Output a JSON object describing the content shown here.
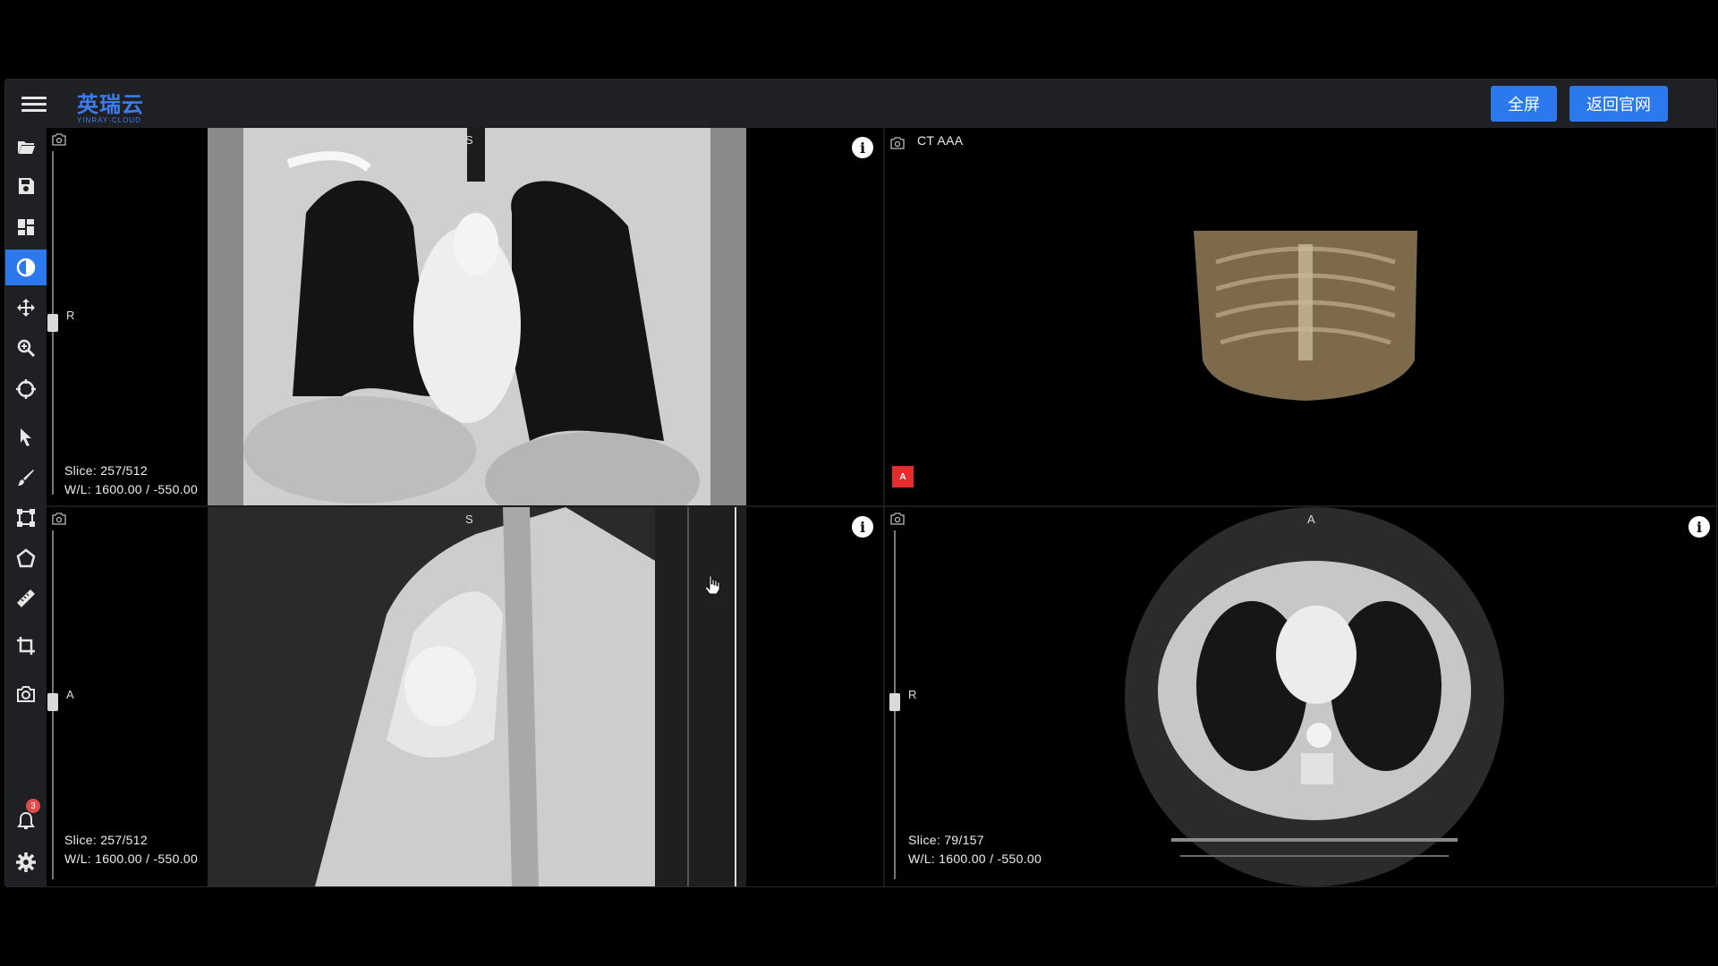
{
  "header": {
    "logo_cn": "英瑞云",
    "logo_en": "YINRAY·CLOUD",
    "fullscreen_label": "全屏",
    "back_label": "返回官网"
  },
  "sidebar": {
    "tools": [
      "folder-open-icon",
      "save-icon",
      "layout-icon",
      "window-level-icon",
      "pan-icon",
      "zoom-icon",
      "crosshair-icon",
      "pointer-icon",
      "brush-icon",
      "bounding-box-icon",
      "polygon-icon",
      "ruler-icon",
      "crop-icon",
      "snapshot-icon",
      "bell-icon",
      "settings-icon"
    ],
    "active_tool": "window-level-icon",
    "notification_count": "3"
  },
  "viewports": {
    "coronal": {
      "orientation_top": "S",
      "orientation_left": "R",
      "slice": "Slice: 257/512",
      "wl": "W/L: 1600.00 / -550.00"
    },
    "volume": {
      "series": "CT AAA",
      "marker": "A"
    },
    "sagittal": {
      "orientation_top": "S",
      "orientation_left": "A",
      "slice": "Slice: 257/512",
      "wl": "W/L: 1600.00 / -550.00"
    },
    "axial": {
      "orientation_top": "A",
      "orientation_left": "R",
      "slice": "Slice: 79/157",
      "wl": "W/L: 1600.00 / -550.00"
    }
  },
  "colors": {
    "accent": "#2c79ee",
    "toolbar_bg": "#1f2023",
    "marker": "#e52b2b"
  }
}
